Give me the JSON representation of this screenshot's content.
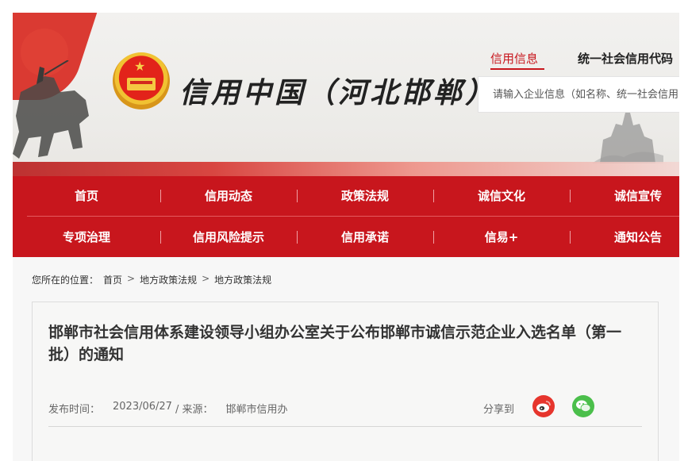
{
  "header": {
    "site_title": "信用中国（河北邯郸）",
    "top_links": [
      "信用信息",
      "统一社会信用代码"
    ],
    "search_placeholder": "请输入企业信息（如名称、统一社会信用"
  },
  "nav": {
    "row1": [
      "首页",
      "信用动态",
      "政策法规",
      "诚信文化",
      "诚信宣传"
    ],
    "row2": [
      "专项治理",
      "信用风险提示",
      "信用承诺",
      "信易+",
      "通知公告"
    ]
  },
  "breadcrumb": {
    "prefix": "您所在的位置：",
    "items": [
      "首页",
      "地方政策法规",
      "地方政策法规"
    ],
    "separator": ">"
  },
  "article": {
    "title": "邯郸市社会信用体系建设领导小组办公室关于公布邯郸市诚信示范企业入选名单（第一批）的通知",
    "publish_label": "发布时间：",
    "publish_date": "2023/06/27",
    "source_label": "/ 来源：",
    "source": "邯郸市信用办",
    "share_label": "分享到"
  },
  "colors": {
    "brand_red": "#c8161d",
    "weibo": "#e6352d",
    "wechat": "#4bbf4b"
  },
  "icons": [
    "national-emblem-icon",
    "weibo-icon",
    "wechat-icon"
  ]
}
